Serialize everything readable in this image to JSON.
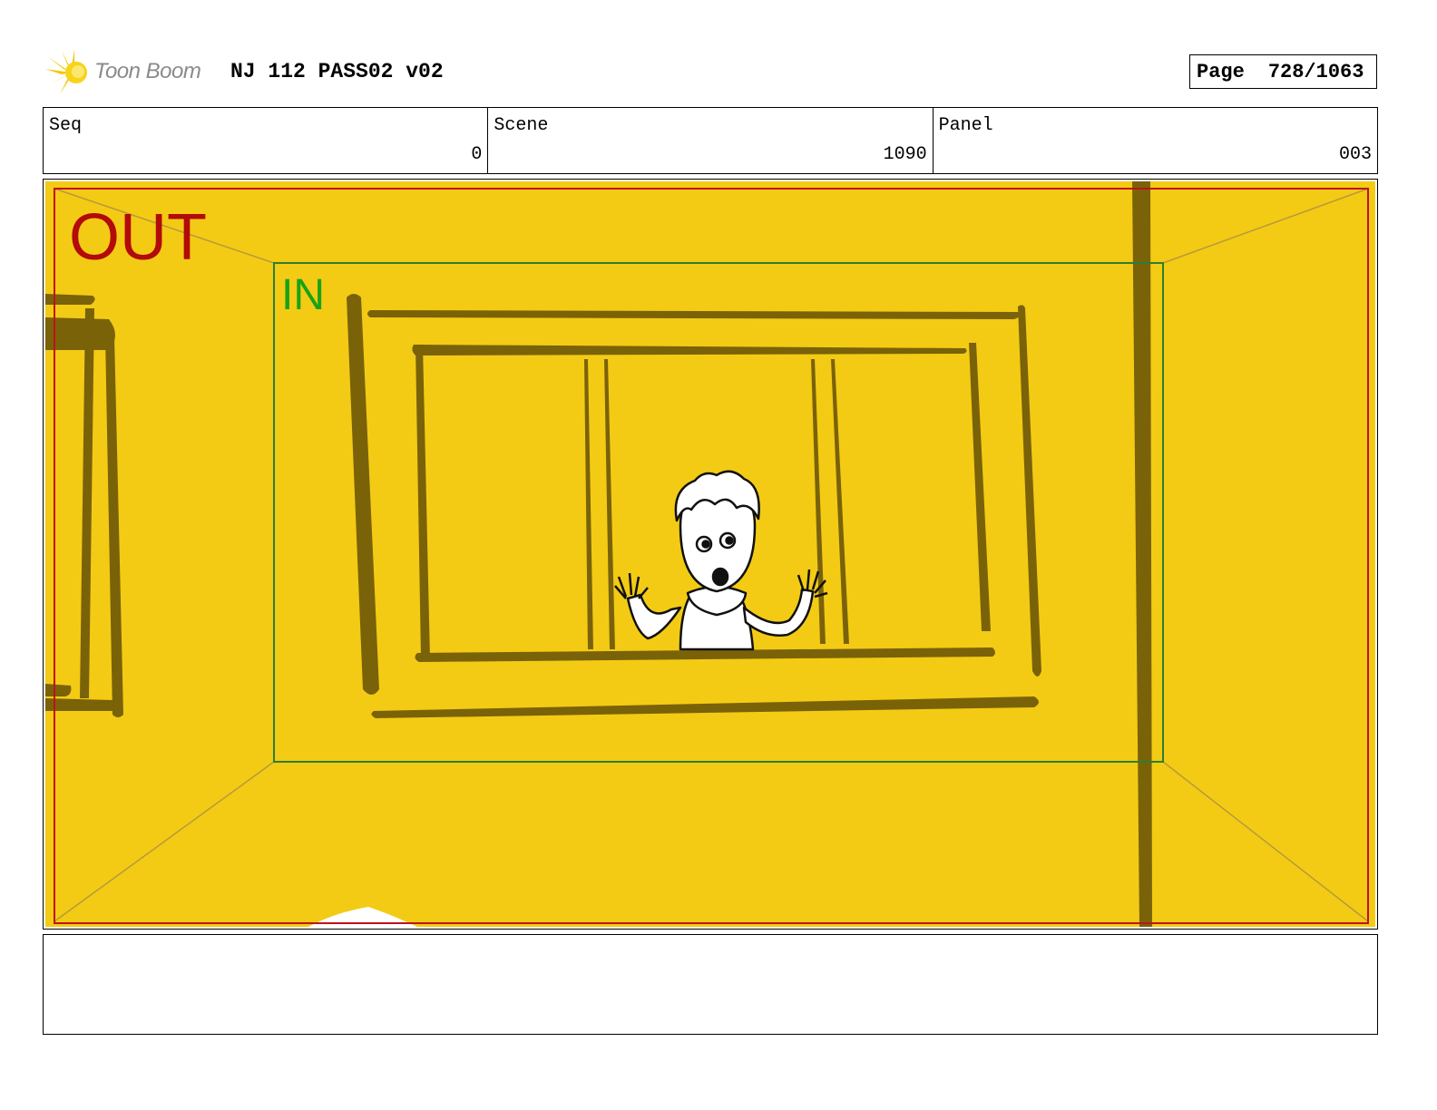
{
  "header": {
    "logo_text": "Toon Boom",
    "project_title": "NJ 112 PASS02 v02",
    "page_label": "Page",
    "page_value": "728/1063"
  },
  "info": {
    "seq": {
      "label": "Seq",
      "value": "0"
    },
    "scene": {
      "label": "Scene",
      "value": "1090"
    },
    "panel": {
      "label": "Panel",
      "value": "003"
    }
  },
  "frame": {
    "out_label": "OUT",
    "in_label": "IN"
  },
  "notes": {
    "text": ""
  },
  "colors": {
    "background": "#F3CB14",
    "strokes": "#7A6209",
    "out_frame": "#C0121A",
    "in_frame": "#2E7D32"
  }
}
